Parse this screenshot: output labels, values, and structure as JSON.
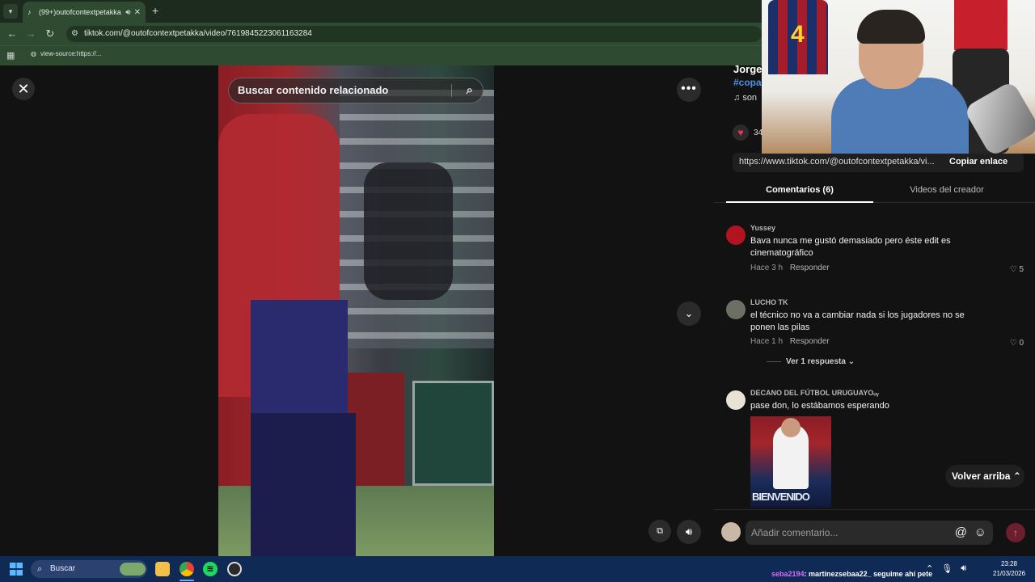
{
  "browser": {
    "tab": {
      "title": "(99+)outofcontextpetakka",
      "favicon": "tiktok-icon"
    },
    "url": "tiktok.com/@outofcontextpetakka/video/7619845223061163284",
    "bookmark": "view-source:https://..."
  },
  "video": {
    "search_placeholder": "Buscar contenido relacionado"
  },
  "panel": {
    "author": "Jorge",
    "hashtag": "#copa",
    "music": "son",
    "like_count": "34",
    "link": "https://www.tiktok.com/@outofcontextpetakka/vi...",
    "copy_label": "Copiar enlace",
    "tabs": [
      {
        "label": "Comentarios (6)",
        "active": true
      },
      {
        "label": "Videos del creador",
        "active": false
      }
    ],
    "comments": [
      {
        "user": "Yussey",
        "text": "Bava nunca me gustó demasiado pero éste edit es cinematográfico",
        "time": "Hace 3 h",
        "reply": "Responder",
        "likes": "5"
      },
      {
        "user": "LUCHO TK",
        "text": "el técnico no va a cambiar nada si los jugadores no se ponen las pilas",
        "time": "Hace 1 h",
        "reply": "Responder",
        "likes": "0",
        "view_replies": "Ver 1 respuesta"
      },
      {
        "user": "DECANO DEL FÚTBOL URUGUAYOᵤᵧ",
        "text": "pase don, lo estábamos esperando",
        "image_caption": "BIENVENIDO"
      }
    ],
    "back_to_top": "Volver arriba",
    "comment_placeholder": "Añadir comentario..."
  },
  "taskbar": {
    "search": "Buscar",
    "ticker_user": "seba2194",
    "ticker_text": ": martinezsebaa22_ seguime ahí pete",
    "time": "23:28",
    "date": "21/03/2026"
  },
  "colors": {
    "accent": "#fe2c55",
    "hashtag": "#4e8fe6",
    "chrome": "#2e4a31"
  }
}
